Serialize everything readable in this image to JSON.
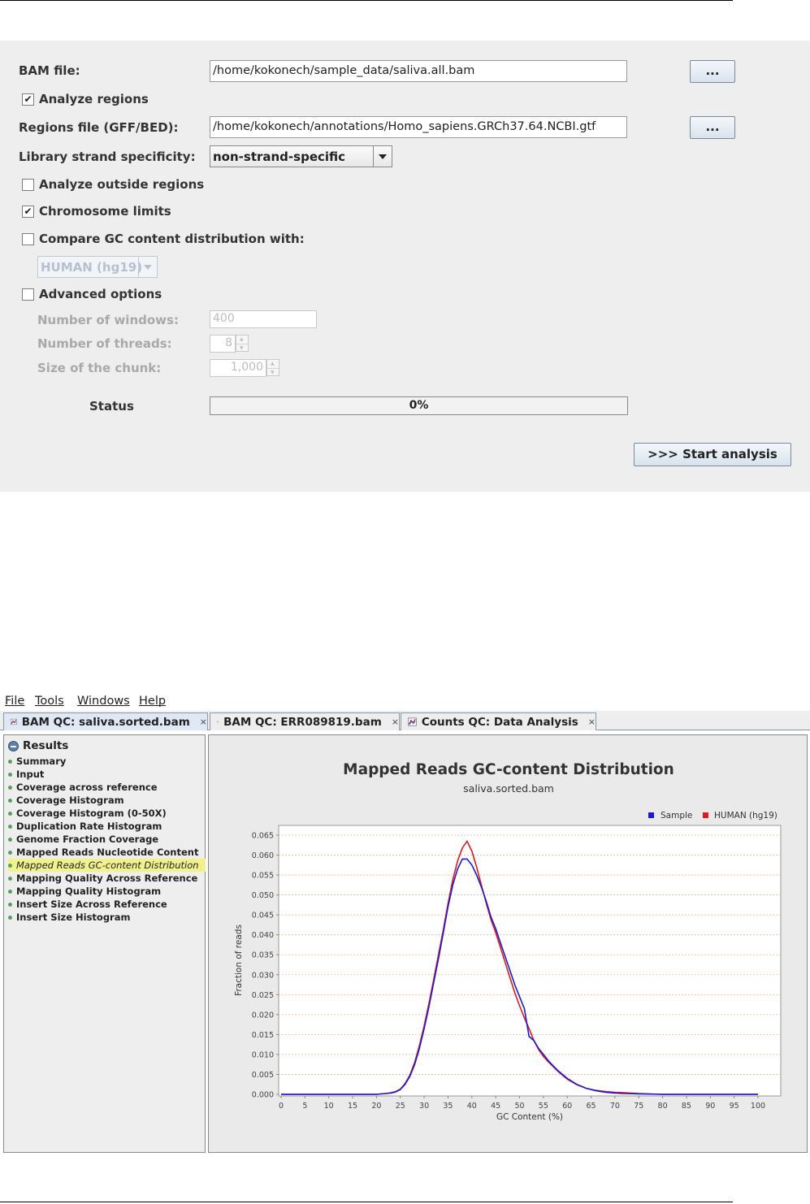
{
  "dialog": {
    "bam_label": "BAM file:",
    "bam_value": "/home/kokonech/sample_data/saliva.all.bam",
    "browse_label": "...",
    "analyze_regions_label": "Analyze regions",
    "analyze_regions_checked": true,
    "regions_label": "Regions file (GFF/BED):",
    "regions_value": "/home/kokonech/annotations/Homo_sapiens.GRCh37.64.NCBI.gtf",
    "strand_label": "Library strand specificity:",
    "strand_value": "non-strand-specific",
    "outside_regions_label": "Analyze outside regions",
    "outside_regions_checked": false,
    "chromosome_limits_label": "Chromosome limits",
    "chromosome_limits_checked": true,
    "compare_gc_label": "Compare GC content distribution with:",
    "compare_gc_checked": false,
    "genome_value": "HUMAN (hg19)",
    "advanced_label": "Advanced options",
    "advanced_checked": false,
    "windows_label": "Number of windows:",
    "windows_value": "400",
    "threads_label": "Number of threads:",
    "threads_value": "8",
    "chunk_label": "Size of the chunk:",
    "chunk_value": "1,000",
    "status_label": "Status",
    "progress_text": "0%",
    "progress_value": 0,
    "start_label": ">>> Start analysis"
  },
  "menubar": {
    "items": [
      {
        "label": "File"
      },
      {
        "label": "Tools"
      },
      {
        "label": "Windows"
      },
      {
        "label": "Help"
      }
    ]
  },
  "tabs": [
    {
      "label": "BAM QC: saliva.sorted.bam",
      "close": "×",
      "active": true
    },
    {
      "label": "BAM QC: ERR089819.bam",
      "close": "×",
      "active": false
    },
    {
      "label": "Counts QC: Data Analysis",
      "close": "×",
      "active": false
    }
  ],
  "tree": {
    "root_label": "Results",
    "items": [
      {
        "label": "Summary"
      },
      {
        "label": "Input"
      },
      {
        "label": "Coverage across reference"
      },
      {
        "label": "Coverage Histogram"
      },
      {
        "label": "Coverage Histogram (0-50X)"
      },
      {
        "label": "Duplication Rate Histogram"
      },
      {
        "label": "Genome Fraction Coverage"
      },
      {
        "label": "Mapped Reads Nucleotide Content"
      },
      {
        "label": "Mapped Reads GC-content Distribution",
        "selected": true
      },
      {
        "label": "Mapping Quality Across Reference"
      },
      {
        "label": "Mapping Quality Histogram"
      },
      {
        "label": "Insert Size Across Reference"
      },
      {
        "label": "Insert Size Histogram"
      }
    ]
  },
  "colors": {
    "sample": "#1a1ad4",
    "human": "#e01a1a",
    "grid": "#f0b98c",
    "selection": "#f2f28c"
  },
  "chart_data": {
    "type": "line",
    "title": "Mapped Reads GC-content Distribution",
    "subtitle": "saliva.sorted.bam",
    "xlabel": "GC Content (%)",
    "ylabel": "Fraction of reads",
    "xlim": [
      0,
      100
    ],
    "ylim": [
      0,
      0.065
    ],
    "xticks": [
      0,
      5,
      10,
      15,
      20,
      25,
      30,
      35,
      40,
      45,
      50,
      55,
      60,
      65,
      70,
      75,
      80,
      85,
      90,
      95,
      100
    ],
    "yticks": [
      0,
      0.005,
      0.01,
      0.015,
      0.02,
      0.025,
      0.03,
      0.035,
      0.04,
      0.045,
      0.05,
      0.055,
      0.06,
      0.065
    ],
    "ytick_labels": [
      "0.000",
      "0.005",
      "0.010",
      "0.015",
      "0.020",
      "0.025",
      "0.030",
      "0.035",
      "0.040",
      "0.045",
      "0.050",
      "0.055",
      "0.060",
      "0.065"
    ],
    "grid": "horizontal",
    "legend_position": "top-right",
    "series": [
      {
        "name": "Sample",
        "color": "#1a1ad4",
        "x": [
          0,
          5,
          10,
          15,
          20,
          22,
          23,
          24,
          25,
          26,
          27,
          28,
          29,
          30,
          31,
          32,
          33,
          34,
          35,
          36,
          37,
          38,
          39,
          40,
          41,
          42,
          43,
          44,
          45,
          46,
          47,
          48,
          49,
          50,
          51,
          52,
          53,
          54,
          55,
          56,
          57,
          58,
          60,
          62,
          64,
          66,
          68,
          70,
          72,
          75,
          80,
          90,
          100
        ],
        "y": [
          0,
          0,
          0,
          0,
          0,
          0.0002,
          0.0003,
          0.0006,
          0.0012,
          0.0025,
          0.0045,
          0.0075,
          0.0115,
          0.0165,
          0.022,
          0.028,
          0.034,
          0.0405,
          0.047,
          0.0525,
          0.0565,
          0.059,
          0.059,
          0.0575,
          0.055,
          0.052,
          0.0485,
          0.0445,
          0.0415,
          0.038,
          0.0345,
          0.031,
          0.0275,
          0.0245,
          0.0215,
          0.0145,
          0.0135,
          0.0115,
          0.01,
          0.0085,
          0.0072,
          0.006,
          0.004,
          0.0025,
          0.0015,
          0.0009,
          0.0005,
          0.0003,
          0.0002,
          0.0001,
          0,
          0,
          0
        ]
      },
      {
        "name": "HUMAN (hg19)",
        "color": "#e01a1a",
        "x": [
          0,
          5,
          10,
          15,
          20,
          22,
          23,
          24,
          25,
          26,
          27,
          28,
          29,
          30,
          31,
          32,
          33,
          34,
          35,
          36,
          37,
          38,
          39,
          40,
          41,
          42,
          43,
          44,
          45,
          46,
          47,
          48,
          49,
          50,
          51,
          52,
          53,
          54,
          55,
          56,
          57,
          58,
          60,
          62,
          64,
          66,
          68,
          70,
          72,
          75,
          80,
          90,
          100
        ],
        "y": [
          0,
          0,
          0,
          0,
          0,
          0.0002,
          0.0004,
          0.0007,
          0.0013,
          0.0027,
          0.0048,
          0.008,
          0.0122,
          0.0172,
          0.0228,
          0.0288,
          0.035,
          0.0412,
          0.0478,
          0.0538,
          0.0585,
          0.0618,
          0.0635,
          0.061,
          0.057,
          0.0525,
          0.048,
          0.0438,
          0.0405,
          0.0368,
          0.033,
          0.0292,
          0.0255,
          0.0222,
          0.0192,
          0.0165,
          0.0135,
          0.0112,
          0.0095,
          0.0082,
          0.007,
          0.0058,
          0.0038,
          0.0024,
          0.0015,
          0.001,
          0.0007,
          0.0005,
          0.0004,
          0.0002,
          0,
          0,
          0
        ]
      }
    ]
  }
}
